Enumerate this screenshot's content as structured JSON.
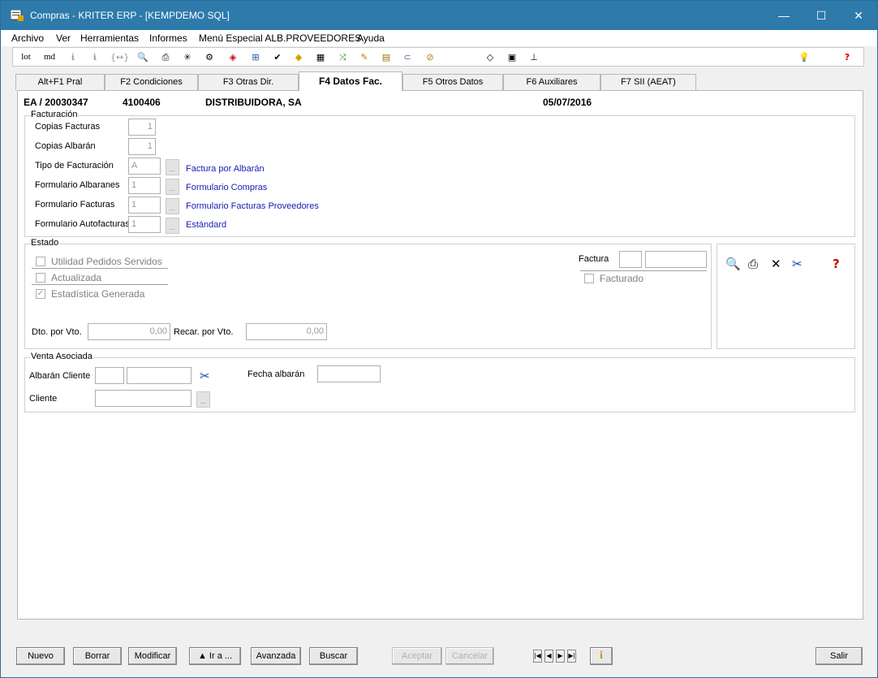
{
  "window": {
    "title": "Compras - KRITER ERP - [KEMPDEMO SQL]",
    "minimize": "—",
    "maximize": "☐",
    "close": "✕"
  },
  "menu": [
    "Archivo",
    "Ver",
    "Herramientas",
    "Informes",
    "Menú Especial ALB.PROVEEDORES",
    "Ayuda"
  ],
  "toolbar": {
    "lot": "lot",
    "md": "md"
  },
  "tabs": [
    {
      "label": "Alt+F1 Pral"
    },
    {
      "label": "F2 Condiciones"
    },
    {
      "label": "F3 Otras Dir."
    },
    {
      "label": "F4 Datos Fac."
    },
    {
      "label": "F5 Otros Datos"
    },
    {
      "label": "F6 Auxiliares"
    },
    {
      "label": "F7 SII (AEAT)"
    }
  ],
  "header": {
    "doc": "EA / 20030347",
    "code": "4100406",
    "supplier": "DISTRIBUIDORA, SA",
    "date": "05/07/2016"
  },
  "facturacion": {
    "title": "Facturación",
    "copias_facturas_label": "Copias Facturas",
    "copias_facturas_value": "1",
    "copias_albaran_label": "Copias Albarán",
    "copias_albaran_value": "1",
    "tipo_label": "Tipo de Facturación",
    "tipo_value": "A",
    "tipo_desc": "Factura por Albarán",
    "form_alb_label": "Formulario Albaranes",
    "form_alb_value": "1",
    "form_alb_desc": "Formulario Compras",
    "form_fac_label": "Formulario Facturas",
    "form_fac_value": "1",
    "form_fac_desc": "Formulario Facturas Proveedores",
    "form_auto_label": "Formulario Autofacturas",
    "form_auto_value": "1",
    "form_auto_desc": "Estándard",
    "ellipsis": "..."
  },
  "estado": {
    "title": "Estado",
    "utilidad": "Utilidad Pedidos Servidos",
    "actualizada": "Actualizada",
    "estadistica": "Estadística Generada",
    "factura_label": "Factura",
    "facturado": "Facturado",
    "dto_label": "Dto. por Vto.",
    "dto_value": "0,00",
    "recar_label": "Recar. por Vto.",
    "recar_value": "0,00",
    "check_mark": "✓"
  },
  "venta": {
    "title": "Venta Asociada",
    "albaran_label": "Albarán Cliente",
    "fecha_label": "Fecha  albarán",
    "cliente_label": "Cliente",
    "ellipsis": "..."
  },
  "buttons": {
    "nuevo": "Nuevo",
    "borrar": "Borrar",
    "modificar": "Modificar",
    "ira": "▲ Ir a ...",
    "avanzada": "Avanzada",
    "buscar": "Buscar",
    "aceptar": "Aceptar",
    "cancelar": "Cancelar",
    "salir": "Salir",
    "info": "i"
  }
}
